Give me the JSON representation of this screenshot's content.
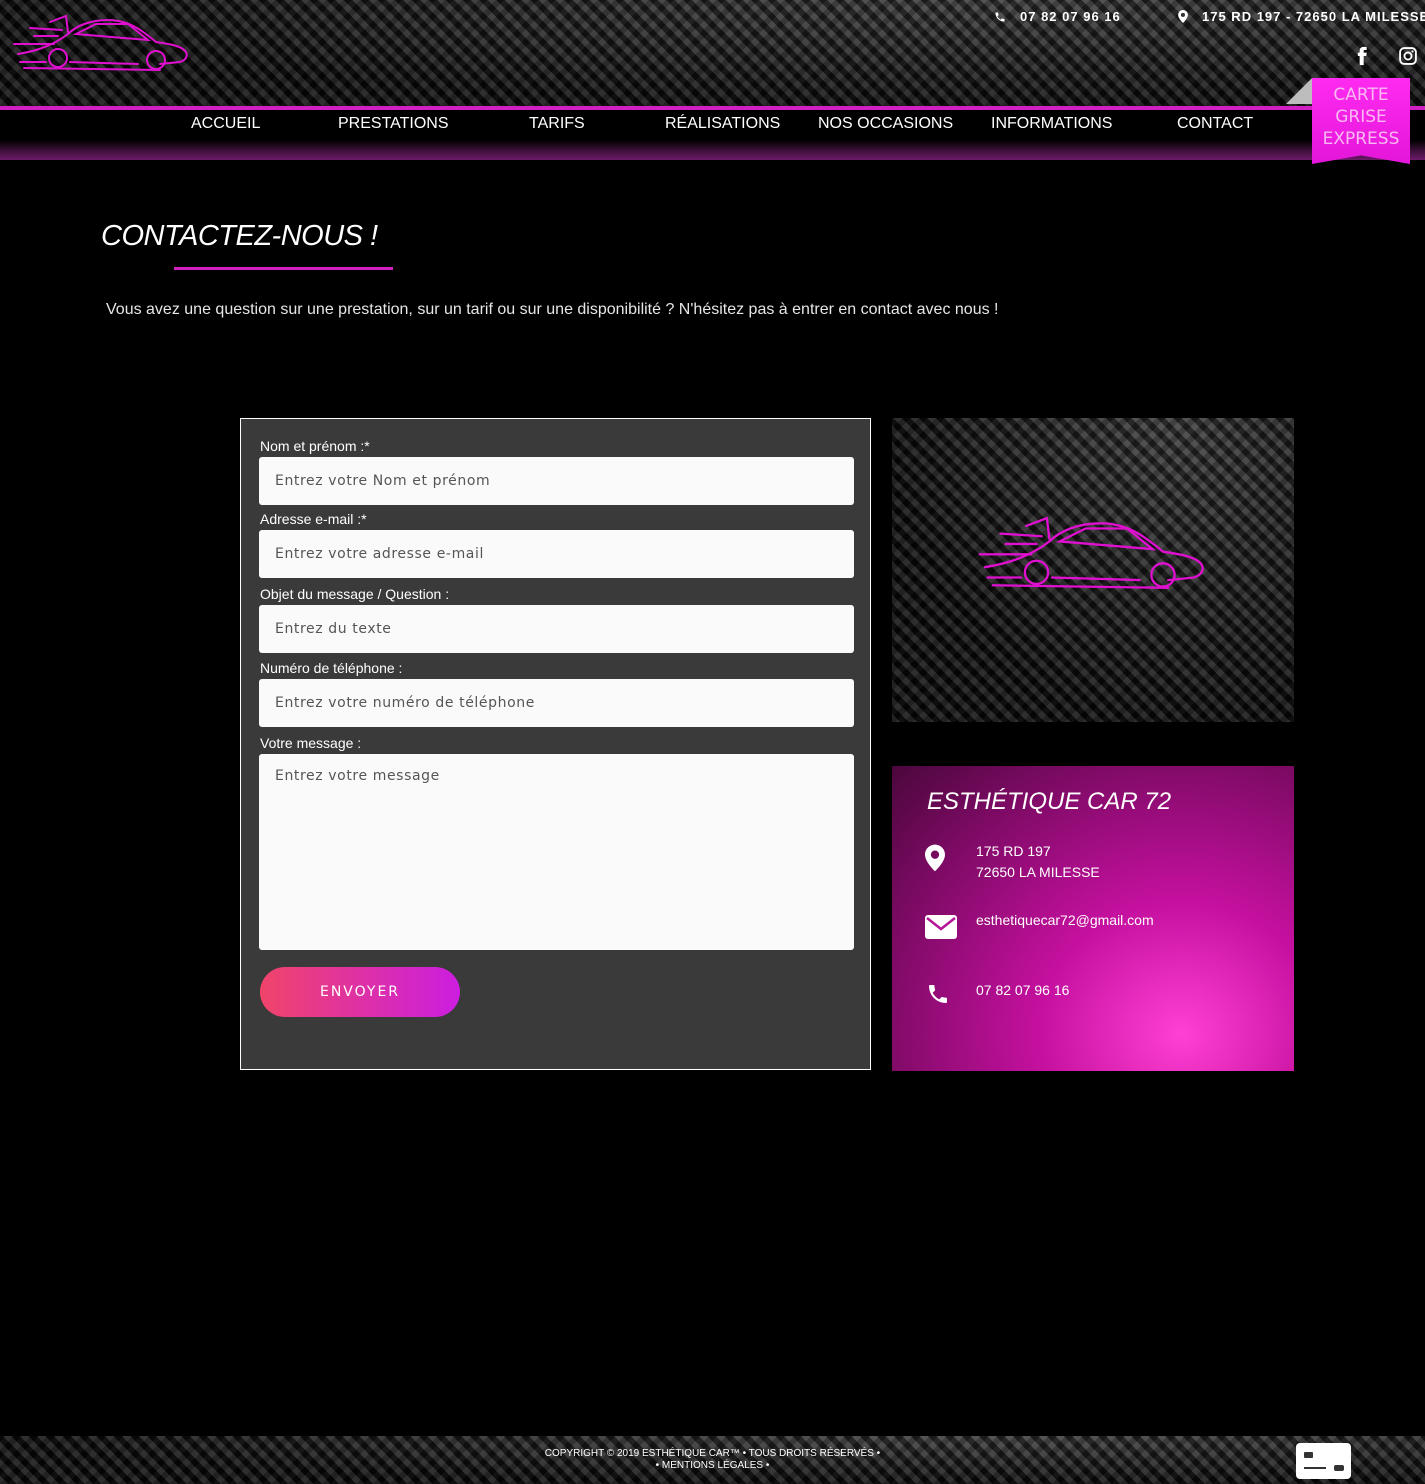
{
  "header": {
    "phone": "07 82 07 96 16",
    "address": "175 RD 197 - 72650 LA MILESSE"
  },
  "nav": {
    "items": [
      {
        "label": "ACCUEIL"
      },
      {
        "label": "PRESTATIONS"
      },
      {
        "label": "TARIFS"
      },
      {
        "label": "RÉALISATIONS"
      },
      {
        "label": "NOS OCCASIONS"
      },
      {
        "label": "INFORMATIONS"
      },
      {
        "label": "CONTACT"
      }
    ],
    "badge": [
      "CARTE",
      "GRISE",
      "EXPRESS"
    ]
  },
  "page": {
    "title": "CONTACTEZ-NOUS !",
    "intro": "Vous avez une question sur une prestation, sur un tarif ou sur une disponibilité ? N'hésitez pas à entrer en contact avec nous !"
  },
  "form": {
    "fields": [
      {
        "label": "Nom et prénom :*",
        "placeholder": "Entrez votre Nom et prénom",
        "value": ""
      },
      {
        "label": "Adresse e-mail :*",
        "placeholder": "Entrez votre adresse e-mail",
        "value": ""
      },
      {
        "label": "Objet du message / Question :",
        "placeholder": "Entrez du texte",
        "value": ""
      },
      {
        "label": "Numéro de téléphone :",
        "placeholder": "Entrez votre numéro de téléphone",
        "value": ""
      },
      {
        "label": "Votre message :",
        "placeholder": "Entrez votre message",
        "value": ""
      }
    ],
    "submit_label": "ENVOYER"
  },
  "info_card": {
    "title": "ESTHÉTIQUE CAR 72",
    "address_line1": "175 RD 197",
    "address_line2": "72650 LA MILESSE",
    "email": "esthetiquecar72@gmail.com",
    "phone": "07 82 07 96 16"
  },
  "footer": {
    "line1": "COPYRIGHT © 2019 ESTHÉTIQUE CAR™ • TOUS DROITS RÉSERVÉS •",
    "line2": "• MENTIONS LÉGALES •"
  },
  "colors": {
    "accent": "#d21fc2",
    "badge": "#e316d9",
    "button_start": "#f0446a",
    "button_end": "#cc1ee0"
  },
  "icons": [
    "car-logo-icon",
    "phone-icon",
    "map-marker-icon",
    "facebook-icon",
    "instagram-icon",
    "envelope-icon",
    "credit-card-icon"
  ]
}
